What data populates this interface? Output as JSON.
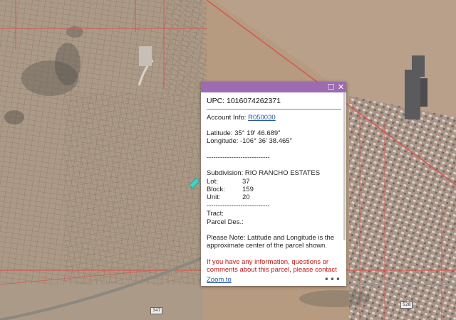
{
  "map": {
    "road_shield_1": "347",
    "road_shield_2": "528"
  },
  "popup": {
    "upc": "UPC: 1016074262371",
    "account_label": "Account Info: ",
    "account_link": "R050030",
    "latitude": "Latitude: 35° 19' 46.689\"",
    "longitude": "Longitude: -106° 36' 38.465\"",
    "divider": "----------------------------",
    "subdivision": "Subdivision: RIO RANCHO ESTATES",
    "lot_label": "Lot:",
    "lot_value": "37",
    "block_label": "Block:",
    "block_value": "159",
    "unit_label": "Unit:",
    "unit_value": "20",
    "tract": "Tract:",
    "parcel_des": "Parcel Des.:",
    "note": "Please Note: Latitude and Longitude is the approximate center of the parcel shown.",
    "info_red": "If you have any information, questions or",
    "info_red_2": "comments about this parcel, please contact",
    "zoom_to": "Zoom to",
    "more": "•••",
    "maximize_glyph": "☐",
    "close_glyph": "✕"
  },
  "colors": {
    "header_bar": "#9c6bb0",
    "parcel_lines": "#d45a52",
    "link": "#2355a3",
    "marker": "#3fd3c4"
  },
  "icons": [
    "maximize-icon",
    "close-icon",
    "more-options-icon",
    "parcel-marker-icon"
  ]
}
